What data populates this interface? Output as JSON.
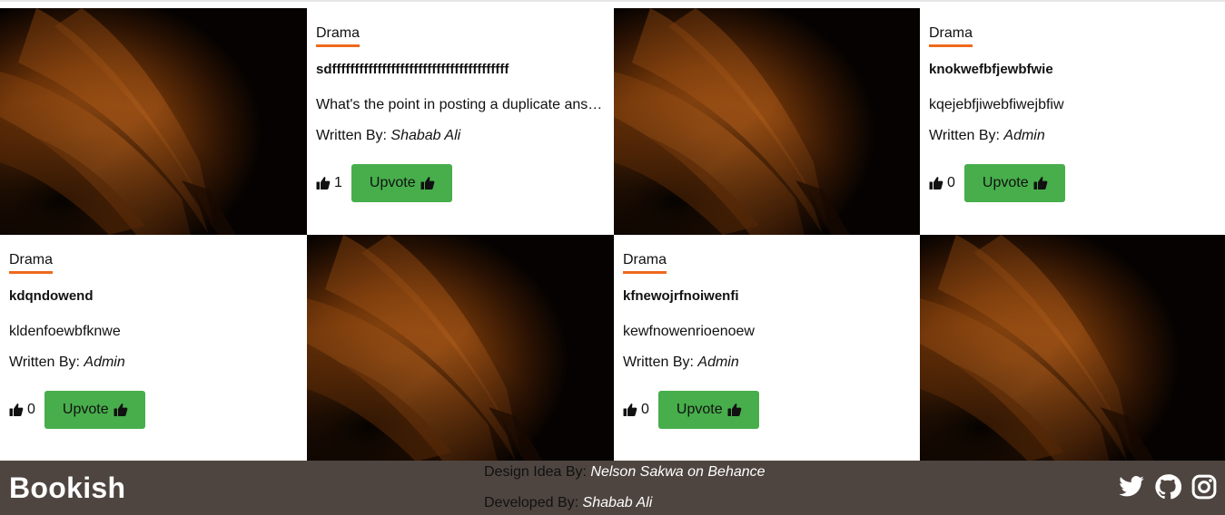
{
  "cards": [
    {
      "genre": "Drama",
      "title": "sdfffffffffffffffffffffffffffffffffffffff",
      "excerpt": "What's the point in posting a duplicate answer?",
      "written_by_label": "Written By:",
      "author": "Shabab Ali",
      "votes": "1",
      "upvote_label": "Upvote"
    },
    {
      "genre": "Drama",
      "title": "knokwefbfjewbfwie",
      "excerpt": "kqejebfjiwebfiwejbfiw",
      "written_by_label": "Written By:",
      "author": "Admin",
      "votes": "0",
      "upvote_label": "Upvote"
    },
    {
      "genre": "Drama",
      "title": "kdqndowend",
      "excerpt": "kldenfoewbfknwe",
      "written_by_label": "Written By:",
      "author": "Admin",
      "votes": "0",
      "upvote_label": "Upvote"
    },
    {
      "genre": "Drama",
      "title": "kfnewojrfnoiwenfi",
      "excerpt": "kewfnowenrioenoew",
      "written_by_label": "Written By:",
      "author": "Admin",
      "votes": "0",
      "upvote_label": "Upvote"
    }
  ],
  "footer": {
    "brand": "Bookish",
    "design_label": "Design Idea By:",
    "design_credit": "Nelson Sakwa on Behance",
    "developed_label": "Developed By:",
    "developer": "Shabab Ali",
    "social_icons": [
      "twitter-icon",
      "github-icon",
      "instagram-icon"
    ]
  },
  "colors": {
    "accent_underline": "#ee6a1b",
    "upvote_button": "#47ae4b",
    "footer_bg": "#4e4540"
  },
  "icons": {
    "thumbs_up": "thumbs-up-icon",
    "book_image": "open-book-photo"
  }
}
